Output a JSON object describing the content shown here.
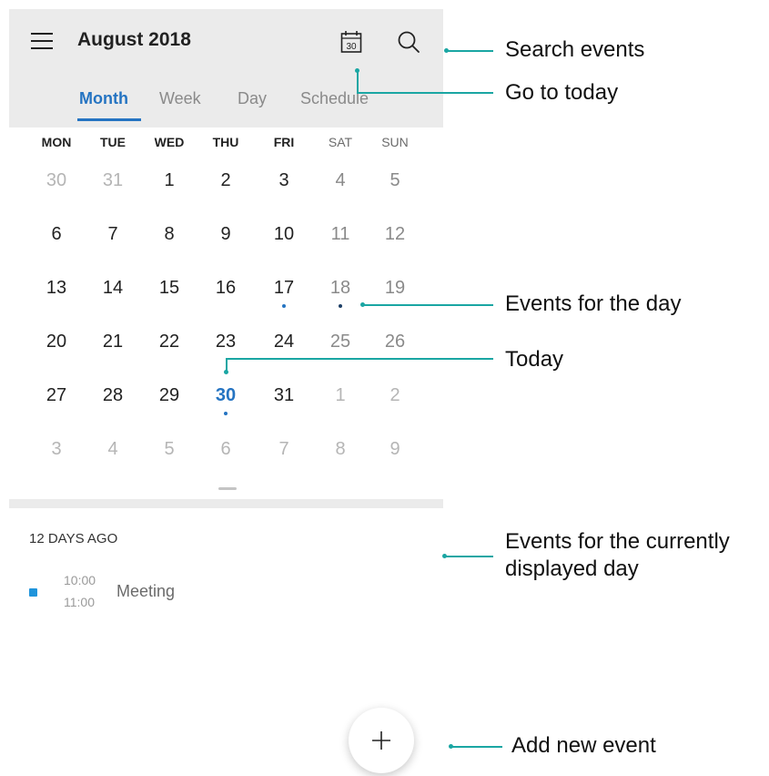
{
  "header": {
    "title": "August 2018",
    "today_icon_day": "30"
  },
  "tabs": [
    {
      "label": "Month",
      "active": true
    },
    {
      "label": "Week",
      "active": false
    },
    {
      "label": "Day",
      "active": false
    },
    {
      "label": "Schedule",
      "active": false
    }
  ],
  "weekdays": [
    "MON",
    "TUE",
    "WED",
    "THU",
    "FRI",
    "SAT",
    "SUN"
  ],
  "calendar": {
    "weeks": [
      [
        "30",
        "31",
        "1",
        "2",
        "3",
        "4",
        "5"
      ],
      [
        "6",
        "7",
        "8",
        "9",
        "10",
        "11",
        "12"
      ],
      [
        "13",
        "14",
        "15",
        "16",
        "17",
        "18",
        "19"
      ],
      [
        "20",
        "21",
        "22",
        "23",
        "24",
        "25",
        "26"
      ],
      [
        "27",
        "28",
        "29",
        "30",
        "31",
        "1",
        "2"
      ],
      [
        "3",
        "4",
        "5",
        "6",
        "7",
        "8",
        "9"
      ]
    ],
    "selected_day": "18",
    "today": "30",
    "days_with_events": [
      "17",
      "18",
      "30"
    ]
  },
  "events": {
    "section_header": "12 DAYS AGO",
    "items": [
      {
        "start": "10:00",
        "end": "11:00",
        "title": "Meeting",
        "color": "#1f94db"
      }
    ]
  },
  "callouts": {
    "search": "Search events",
    "today": "Go to today",
    "events_for_day": "Events for the day",
    "today_marker": "Today",
    "current_day_line1": "Events for the currently",
    "current_day_line2": "displayed day",
    "add": "Add new event"
  },
  "colors": {
    "accent": "#2574c2",
    "callout": "#1aa6a3",
    "selected": "#b6d3ee",
    "toolbar_bg": "#ebebeb"
  }
}
